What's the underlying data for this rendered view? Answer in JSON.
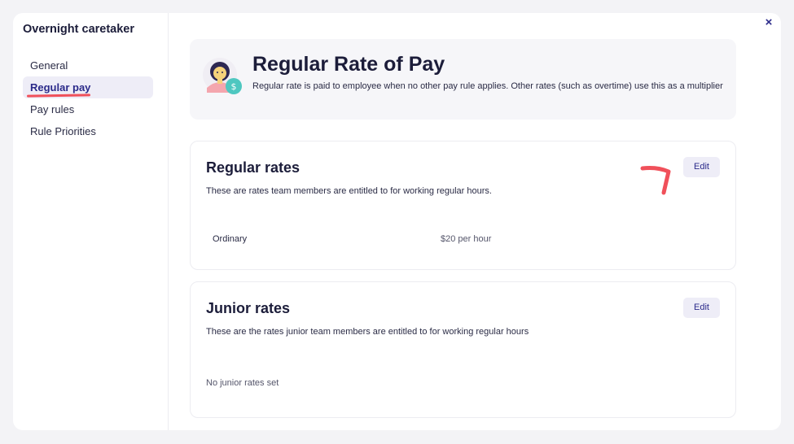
{
  "sidebar": {
    "title": "Overnight caretaker",
    "items": [
      {
        "label": "General",
        "active": false
      },
      {
        "label": "Regular pay",
        "active": true
      },
      {
        "label": "Pay rules",
        "active": false
      },
      {
        "label": "Rule Priorities",
        "active": false
      }
    ]
  },
  "close_icon": "×",
  "hero": {
    "title": "Regular Rate of Pay",
    "description": "Regular rate is paid to employee when no other pay rule applies. Other rates (such as overtime) use this as a multiplier",
    "badge_icon": "dollar-icon"
  },
  "regular_rates": {
    "title": "Regular rates",
    "description": "These are rates team members are entitled to for working regular hours.",
    "edit_label": "Edit",
    "rows": [
      {
        "name": "Ordinary",
        "value": "$20 per hour"
      }
    ]
  },
  "junior_rates": {
    "title": "Junior rates",
    "description": "These are the rates junior team members are entitled to for working regular hours",
    "edit_label": "Edit",
    "empty_text": "No junior rates set"
  },
  "colors": {
    "accent": "#2b2a8a",
    "annotation": "#f0505a",
    "active_bg": "#eeedf7"
  }
}
